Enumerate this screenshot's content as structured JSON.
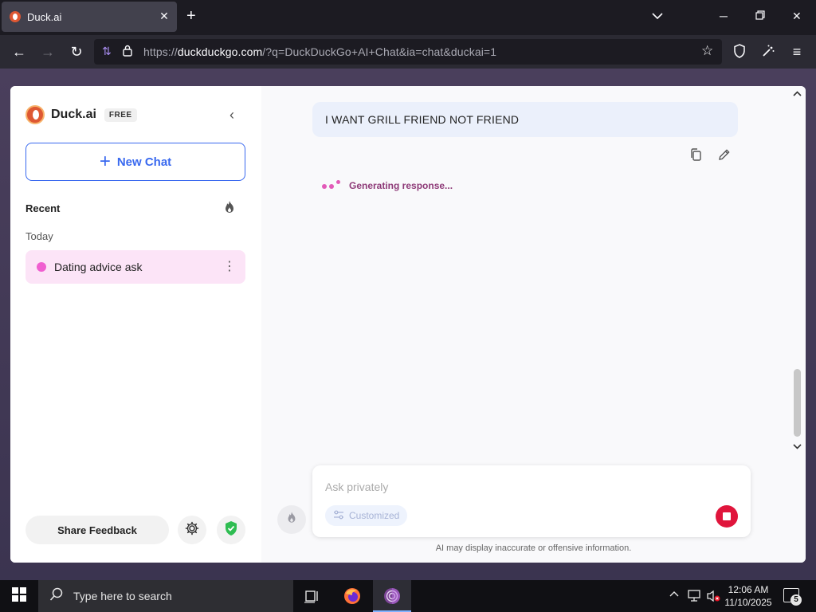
{
  "browser": {
    "tab_title": "Duck.ai",
    "url_prefix": "https://",
    "url_host": "duckduckgo.com",
    "url_rest": "/?q=DuckDuckGo+AI+Chat&ia=chat&duckai=1"
  },
  "sidebar": {
    "brand_name": "Duck.ai",
    "badge": "FREE",
    "new_chat_label": "New Chat",
    "recent_label": "Recent",
    "today_label": "Today",
    "chats": [
      {
        "title": "Dating advice ask",
        "dot_color": "#f05fd0"
      }
    ],
    "share_feedback_label": "Share Feedback"
  },
  "conversation": {
    "user_message": "I WANT GRILL FRIEND NOT FRIEND",
    "status_text": "Generating response..."
  },
  "composer": {
    "placeholder": "Ask privately",
    "mode_label": "Customized"
  },
  "disclaimer": "AI may display inaccurate or offensive information.",
  "taskbar": {
    "search_placeholder": "Type here to search",
    "time": "12:06 AM",
    "date": "11/10/2025",
    "notification_count": "5"
  },
  "colors": {
    "accent": "#3969ef",
    "chat_highlight": "#fce4f7",
    "stop_button": "#e0153c",
    "brand_orange": "#de5833"
  }
}
